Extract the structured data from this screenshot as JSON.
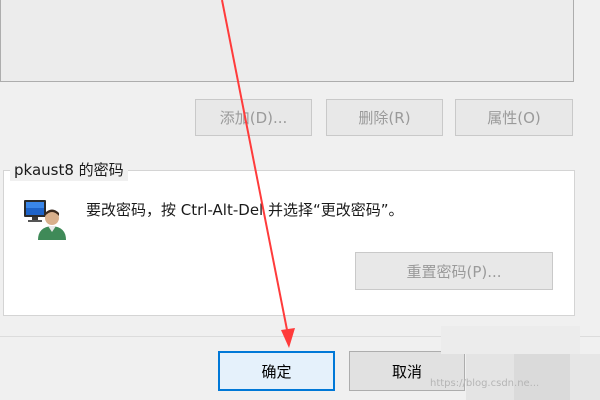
{
  "buttons": {
    "add_label": "添加(D)...",
    "delete_label": "删除(R)",
    "properties_label": "属性(O)",
    "reset_password_label": "重置密码(P)...",
    "ok_label": "确定",
    "cancel_label": "取消"
  },
  "password_group": {
    "title": "pkaust8 的密码",
    "instruction": "要改密码，按 Ctrl-Alt-Del 并选择“更改密码”。",
    "icon": "user-computer-icon"
  },
  "watermark": {
    "text": "https://blog.csdn.ne..."
  },
  "annotation": {
    "arrow_color": "#ff3b3b"
  },
  "colors": {
    "ok_border": "#0078d7",
    "ok_background": "#e5f1fb",
    "disabled_text": "#9a9a9a"
  }
}
